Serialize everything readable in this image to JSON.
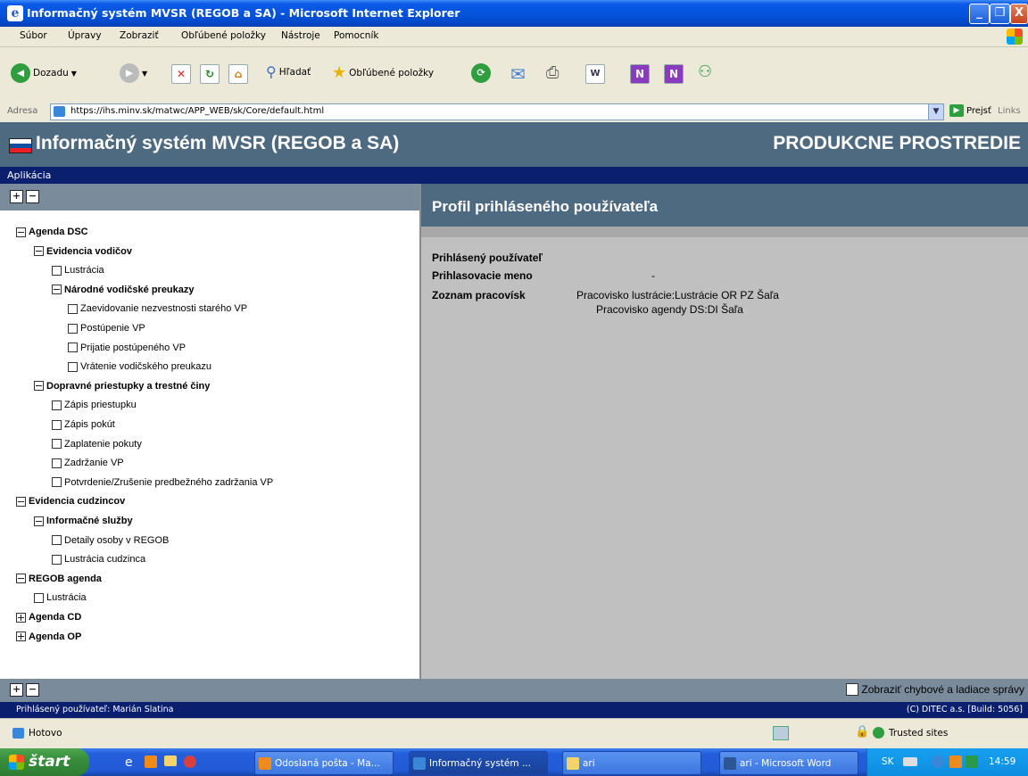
{
  "window": {
    "title": "Informačný systém MVSR (REGOB a SA) - Microsoft Internet Explorer",
    "buttons": [
      "_",
      "❐",
      "X"
    ]
  },
  "menubar": [
    "Súbor",
    "Úpravy",
    "Zobraziť",
    "Obľúbené položky",
    "Nástroje",
    "Pomocník"
  ],
  "toolbar": {
    "back": "Dozadu",
    "search": "Hľadať",
    "favorites": "Obľúbené položky"
  },
  "addressbar": {
    "label": "Adresa",
    "url": "https://ihs.minv.sk/matwc/APP_WEB/sk/Core/default.html",
    "go": "Prejsť",
    "links": "Links"
  },
  "app": {
    "title": "Informačný systém MVSR (REGOB a SA)",
    "environment": "PRODUKCNE PROSTREDIE",
    "menu": "Aplikácia"
  },
  "tree": [
    {
      "label": "Agenda DSC",
      "level": 0,
      "bold": true,
      "icon": "minus"
    },
    {
      "label": "Evidencia vodičov",
      "level": 1,
      "bold": true,
      "icon": "minus"
    },
    {
      "label": "Lustrácia",
      "level": 2,
      "bold": false,
      "icon": "leaf"
    },
    {
      "label": "Národné vodičské preukazy",
      "level": 2,
      "bold": true,
      "icon": "minus"
    },
    {
      "label": "Zaevidovanie nezvestnosti starého VP",
      "level": 3,
      "bold": false,
      "icon": "leaf"
    },
    {
      "label": "Postúpenie VP",
      "level": 3,
      "bold": false,
      "icon": "leaf"
    },
    {
      "label": "Prijatie postúpeného VP",
      "level": 3,
      "bold": false,
      "icon": "leaf"
    },
    {
      "label": "Vrátenie vodičského preukazu",
      "level": 3,
      "bold": false,
      "icon": "leaf"
    },
    {
      "label": "Dopravné priestupky a trestné činy",
      "level": 1,
      "bold": true,
      "icon": "minus"
    },
    {
      "label": "Zápis priestupku",
      "level": 2,
      "bold": false,
      "icon": "leaf"
    },
    {
      "label": "Zápis pokút",
      "level": 2,
      "bold": false,
      "icon": "leaf"
    },
    {
      "label": "Zaplatenie pokuty",
      "level": 2,
      "bold": false,
      "icon": "leaf"
    },
    {
      "label": "Zadržanie VP",
      "level": 2,
      "bold": false,
      "icon": "leaf"
    },
    {
      "label": "Potvrdenie/Zrušenie predbežného zadržania VP",
      "level": 2,
      "bold": false,
      "icon": "leaf"
    },
    {
      "label": "Evidencia cudzincov",
      "level": 0,
      "bold": true,
      "icon": "minus"
    },
    {
      "label": "Informačné služby",
      "level": 1,
      "bold": true,
      "icon": "minus"
    },
    {
      "label": "Detaily osoby v REGOB",
      "level": 2,
      "bold": false,
      "icon": "leaf"
    },
    {
      "label": "Lustrácia cudzinca",
      "level": 2,
      "bold": false,
      "icon": "leaf"
    },
    {
      "label": "REGOB agenda",
      "level": 0,
      "bold": true,
      "icon": "minus"
    },
    {
      "label": "Lustrácia",
      "level": 1,
      "bold": false,
      "icon": "leaf"
    },
    {
      "label": "Agenda CD",
      "level": 0,
      "bold": true,
      "icon": "plus"
    },
    {
      "label": "Agenda OP",
      "level": 0,
      "bold": true,
      "icon": "plus"
    }
  ],
  "profile": {
    "heading": "Profil prihláseného používateľa",
    "user_label": "Prihlásený používateľ",
    "login_label": "Prihlasovacie meno",
    "login_value": "-",
    "workplaces_label": "Zoznam pracovísk",
    "workplaces": [
      "Pracovisko lustrácie:Lustrácie OR PZ Šaľa",
      "Pracovisko agendy DS:DI Šaľa"
    ]
  },
  "debug_label": "Zobraziť chybové a ladiace správy",
  "footer": {
    "user": "Prihlásený používateľ: Marián Slatina",
    "build": "(C) DITEC a.s. [Build: 5056]"
  },
  "statusbar": {
    "text": "Hotovo",
    "zone": "Trusted sites"
  },
  "taskbar": {
    "start": "štart",
    "tasks": [
      "Odoslaná pošta - Ma...",
      "Informačný systém ...",
      "ari",
      "ari - Microsoft Word"
    ],
    "lang": "SK",
    "clock": "14:59"
  }
}
